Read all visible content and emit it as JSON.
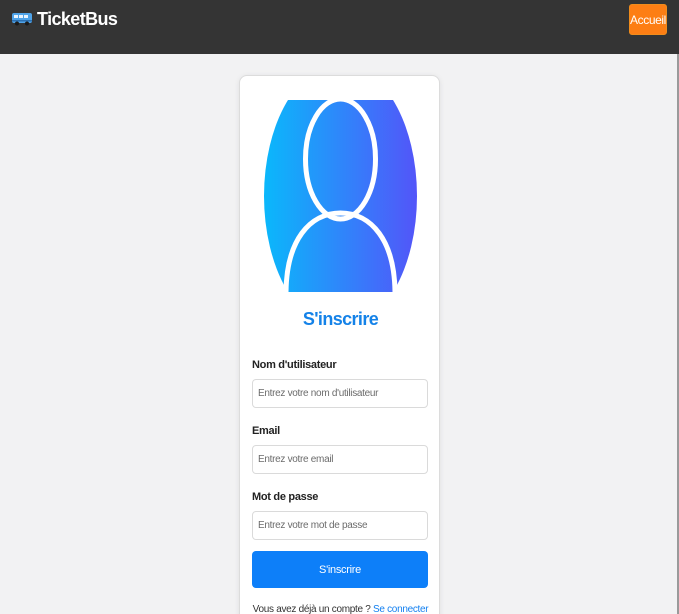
{
  "navbar": {
    "brand": "TicketBus",
    "brand_icon": "bus-icon",
    "home_label": "Accueil",
    "home_color": "#fd7e14"
  },
  "register": {
    "avatar_icon": "user-avatar-icon",
    "title": "S'inscrire",
    "username": {
      "label": "Nom d'utilisateur",
      "placeholder": "Entrez votre nom d'utilisateur"
    },
    "email": {
      "label": "Email",
      "placeholder": "Entrez votre email"
    },
    "password": {
      "label": "Mot de passe",
      "placeholder": "Entrez votre mot de passe"
    },
    "submit_label": "S'inscrire",
    "login_prompt": "Vous avez déjà un compte ?",
    "login_link": "Se connecter",
    "accent_color": "#1482e8",
    "button_color": "#0d7ff9"
  }
}
